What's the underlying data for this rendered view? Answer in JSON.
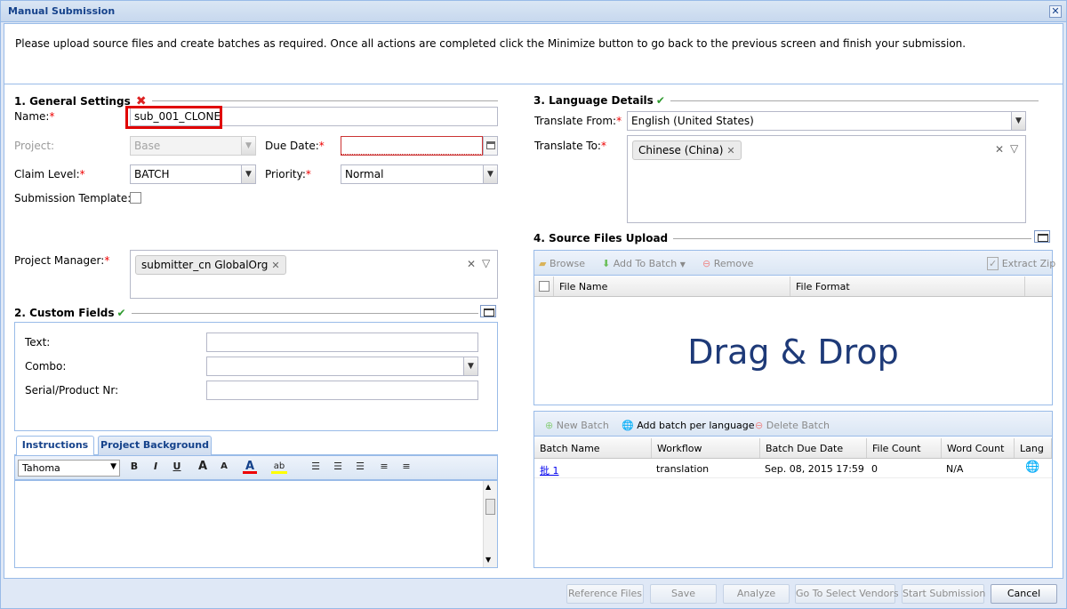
{
  "window": {
    "title": "Manual Submission",
    "close": "✕"
  },
  "notice": "Please upload source files and create batches as required. Once all actions are completed click the Minimize button to go back to the previous screen and finish your submission.",
  "general": {
    "title": "1. General Settings",
    "name_label": "Name:",
    "name_value": "sub_001_CLONE",
    "project_label": "Project:",
    "project_value": "Base",
    "due_label": "Due Date:",
    "due_value": "",
    "claim_label": "Claim Level:",
    "claim_value": "BATCH",
    "priority_label": "Priority:",
    "priority_value": "Normal",
    "template_label": "Submission Template:",
    "pm_label": "Project Manager:",
    "pm_tag": "submitter_cn GlobalOrg"
  },
  "custom": {
    "title": "2. Custom Fields",
    "text_label": "Text:",
    "combo_label": "Combo:",
    "serial_label": "Serial/Product Nr:"
  },
  "editor": {
    "tabs": [
      "Instructions",
      "Project Background"
    ],
    "font": "Tahoma",
    "bold": "B",
    "italic": "I",
    "underline": "U",
    "grow": "A",
    "shrink": "A",
    "color": "A",
    "highlight": "ab"
  },
  "language": {
    "title": "3. Language Details",
    "from_label": "Translate From:",
    "from_value": "English (United States)",
    "to_label": "Translate To:",
    "to_tag": "Chinese (China)"
  },
  "upload": {
    "title": "4. Source Files Upload",
    "browse": "Browse",
    "add_to_batch": "Add To Batch",
    "remove": "Remove",
    "extract_zip": "Extract Zip",
    "col_file_name": "File Name",
    "col_file_format": "File Format",
    "drag_drop": "Drag & Drop"
  },
  "batches": {
    "new_batch": "New Batch",
    "add_per_lang": "Add batch per language",
    "delete_batch": "Delete Batch",
    "columns": [
      "Batch Name",
      "Workflow",
      "Batch Due Date",
      "File Count",
      "Word Count",
      "Lang"
    ],
    "rows": [
      {
        "name": "批 1",
        "workflow": "translation",
        "due": "Sep. 08, 2015 17:59",
        "files": "0",
        "words": "N/A"
      }
    ]
  },
  "footer": {
    "reference": "Reference Files",
    "save": "Save",
    "analyze": "Analyze",
    "vendors": "Go To Select Vendors",
    "start": "Start Submission",
    "cancel": "Cancel"
  },
  "colors": {
    "accent": "#15428b",
    "border": "#99bbe8",
    "highlight_box": "#e00000",
    "check": "#2e9a2e"
  }
}
